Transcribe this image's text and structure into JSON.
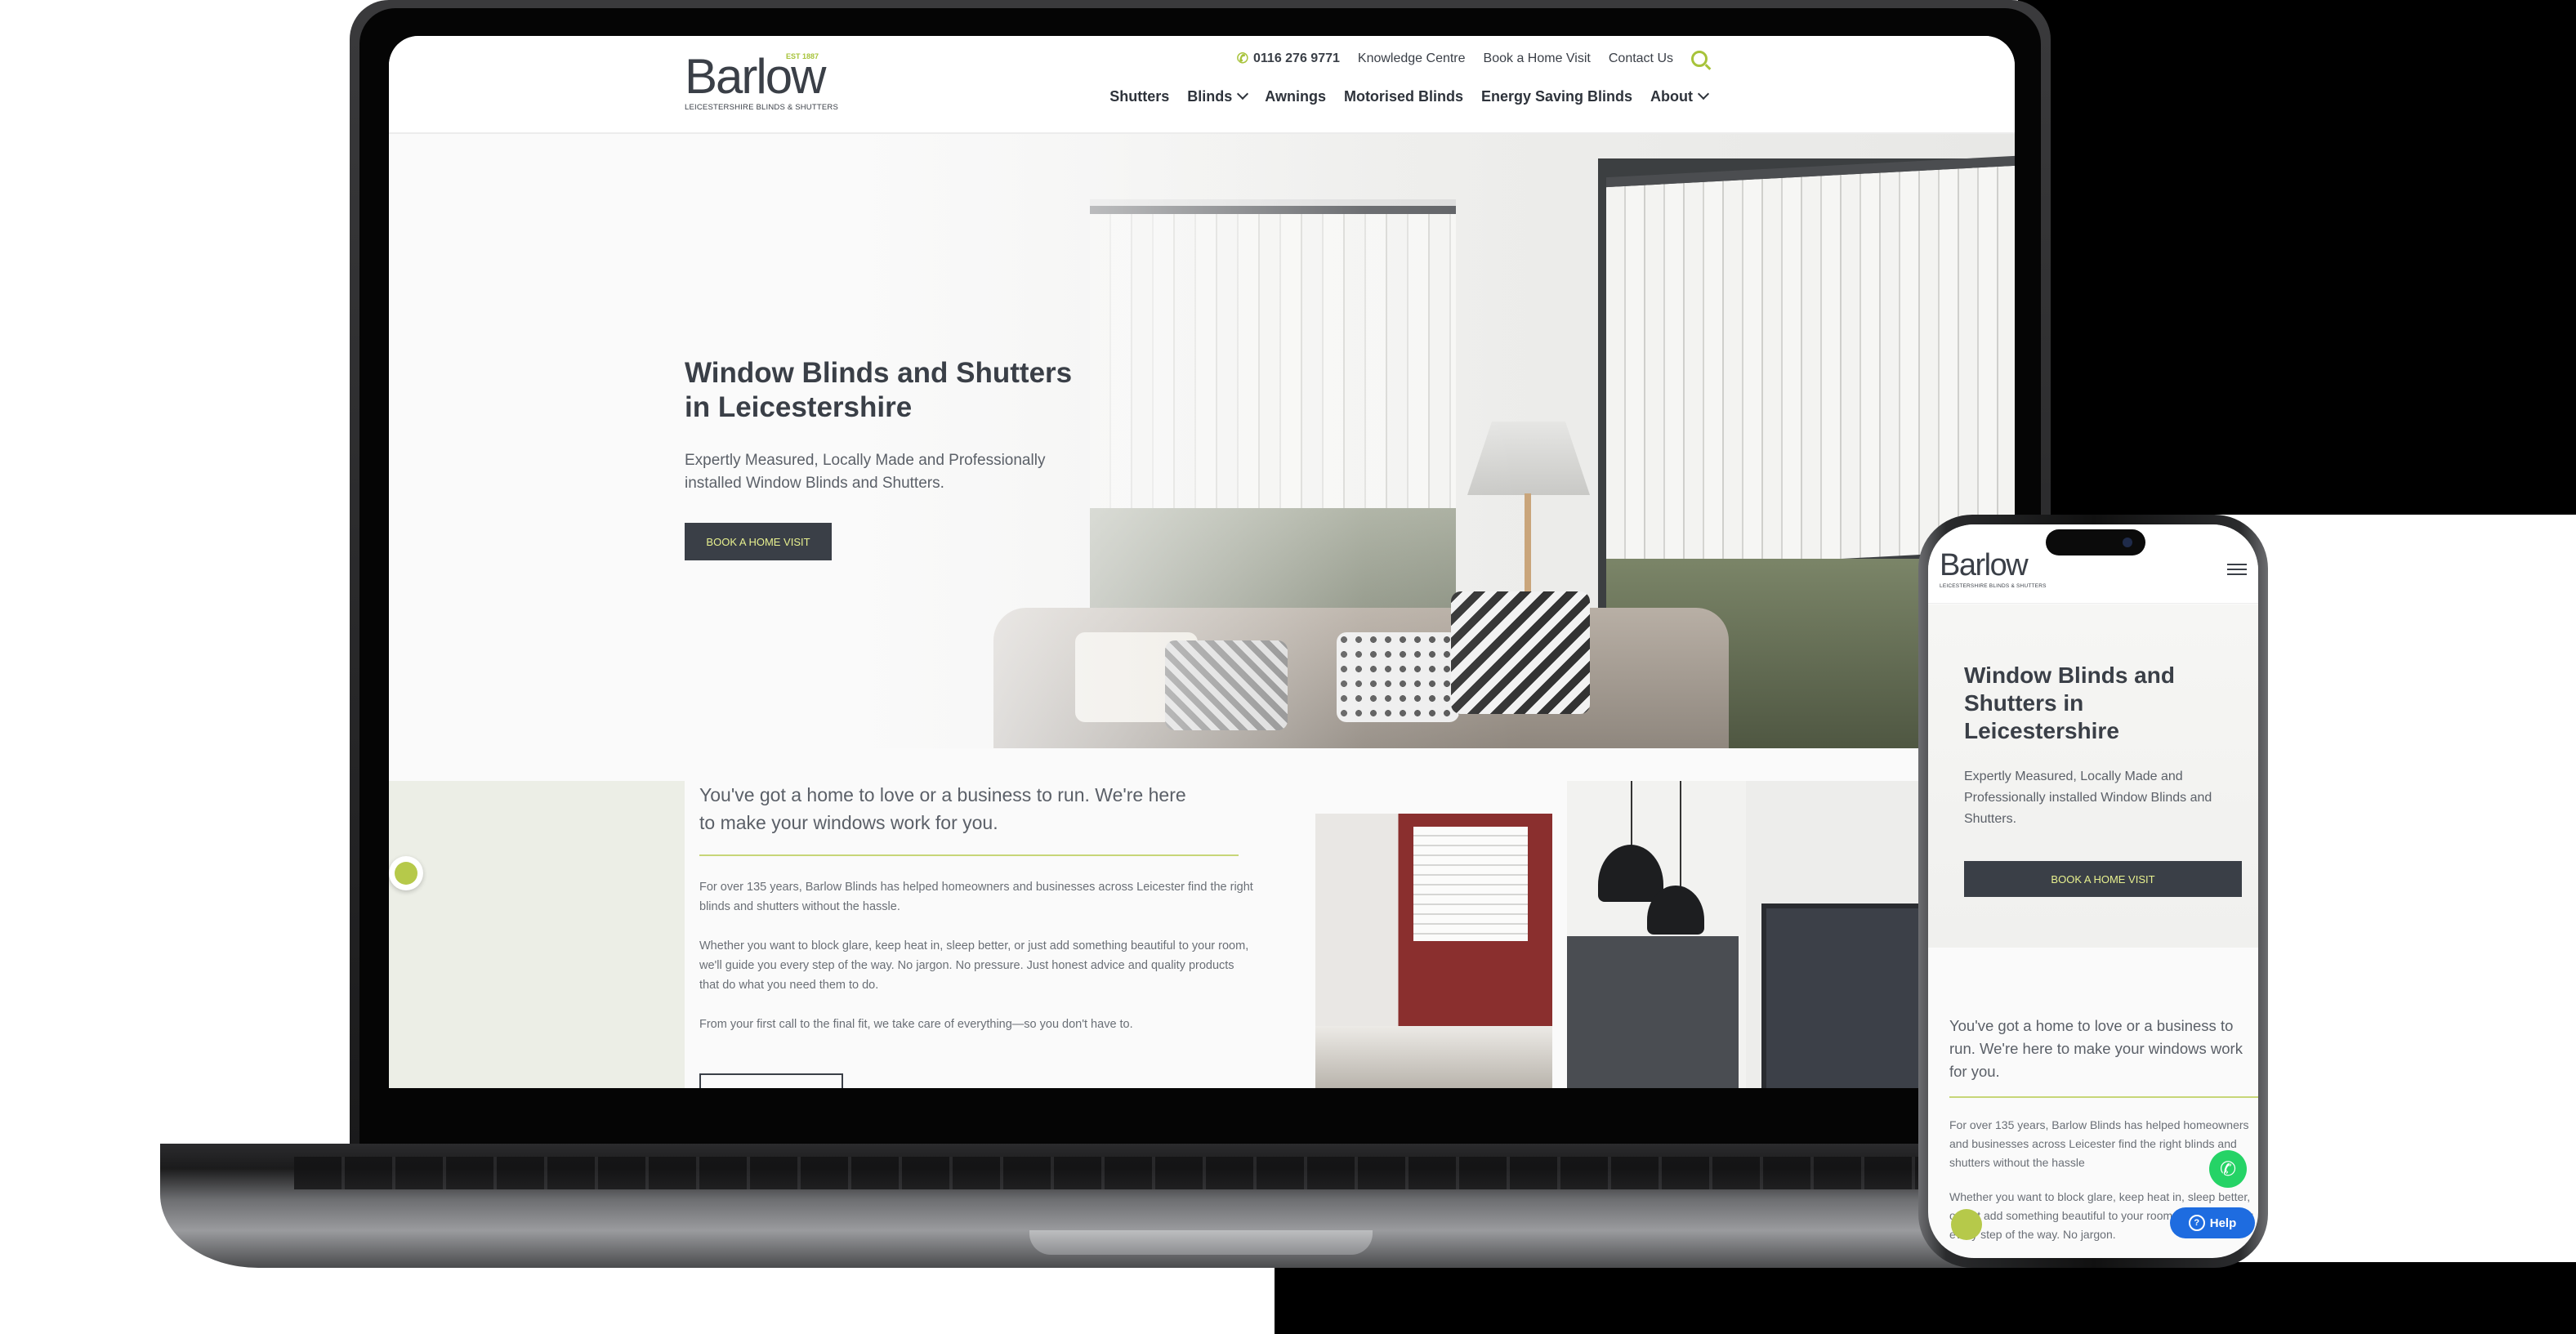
{
  "brand": {
    "logo_word": "Barlow",
    "logo_est": "EST 1887",
    "logo_tagline": "LEICESTERSHIRE BLINDS & SHUTTERS"
  },
  "top_links": {
    "phone": "0116 276 9771",
    "knowledge": "Knowledge Centre",
    "book": "Book a Home Visit",
    "contact": "Contact Us"
  },
  "nav": [
    {
      "label": "Shutters",
      "dropdown": false
    },
    {
      "label": "Blinds",
      "dropdown": true
    },
    {
      "label": "Awnings",
      "dropdown": false
    },
    {
      "label": "Motorised Blinds",
      "dropdown": false
    },
    {
      "label": "Energy Saving Blinds",
      "dropdown": false
    },
    {
      "label": "About",
      "dropdown": true
    }
  ],
  "hero": {
    "title": "Window Blinds and Shutters in Leicestershire",
    "subtitle": "Expertly Measured, Locally Made and Professionally installed Window Blinds and Shutters.",
    "button": "BOOK A HOME VISIT"
  },
  "intro": {
    "heading": "You've got a home to love or a business to run. We're here to make your windows work for you.",
    "p1": "For over 135 years, Barlow Blinds has helped homeowners and businesses across Leicester find the right blinds and shutters without the hassle.",
    "p2": "Whether you want to block glare, keep heat in, sleep better, or just add something beautiful to your room, we'll guide you every step of the way. No jargon. No pressure. Just honest advice and quality products that do what you need them to do.",
    "p3": "From your first call to the final fit, we take care of everything—so you don't have to."
  },
  "mobile": {
    "hero_title": "Window Blinds and Shutters in Leicestershire",
    "hero_subtitle": "Expertly Measured, Locally Made and Professionally installed Window Blinds and Shutters.",
    "button": "BOOK A HOME VISIT",
    "heading": "You've got a home to love or a business to run. We're here to make your windows work for you.",
    "p1": "For over 135 years, Barlow Blinds has helped homeowners and businesses across Leicester find the right blinds and shutters without the hassle",
    "p2": "Whether you want to block glare, keep heat in, sleep better, or just add something beautiful to your room, we'll guide you every step of the way. No jargon.",
    "help": "Help"
  },
  "colors": {
    "accent": "#a7c33a",
    "dark": "#3a3f47",
    "button_text": "#e7f08f",
    "help_blue": "#1e6ce0",
    "whatsapp": "#25d366"
  },
  "icons": [
    "phone-icon",
    "search-icon",
    "chevron-down-icon",
    "cookie-icon",
    "hamburger-icon",
    "whatsapp-icon",
    "help-icon"
  ]
}
